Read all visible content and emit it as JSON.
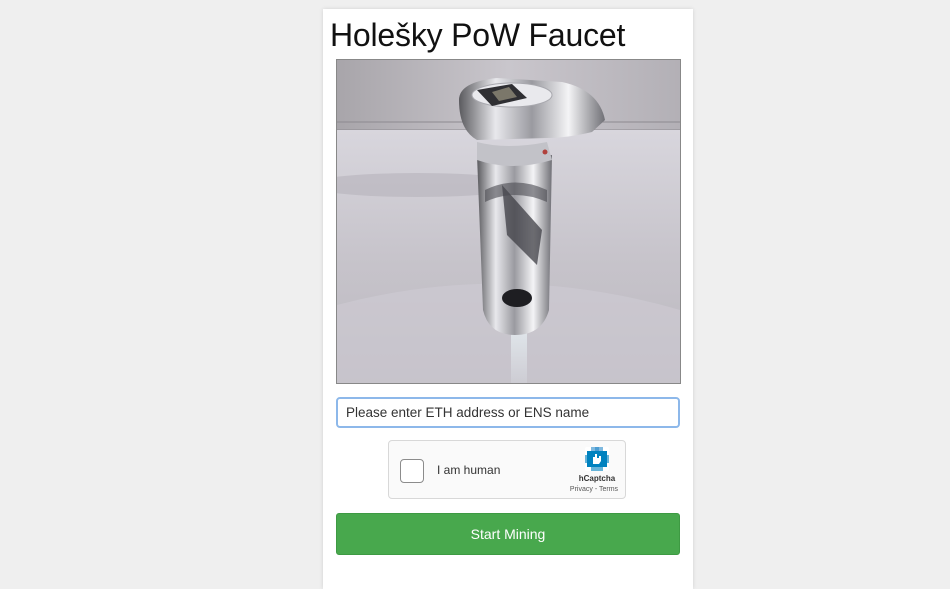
{
  "page": {
    "title": "Holešky PoW Faucet"
  },
  "image": {
    "alt": "Faucet with Ethereum logo",
    "icon": "ethereum-faucet-photo"
  },
  "address_input": {
    "placeholder": "Please enter ETH address or ENS name",
    "value": ""
  },
  "captcha": {
    "checkbox_label": "I am human",
    "brand": "hCaptcha",
    "privacy_link": "Privacy",
    "separator": "-",
    "terms_link": "Terms",
    "logo_icon": "hcaptcha-hand-icon"
  },
  "start_button": {
    "label": "Start Mining"
  },
  "colors": {
    "background": "#efefef",
    "card": "#ffffff",
    "button": "#48a84d",
    "input_border": "#8db8ea"
  }
}
